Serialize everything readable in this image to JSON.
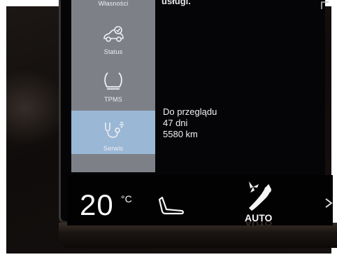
{
  "sidebar": {
    "top_label": "Własności",
    "items": [
      {
        "label": "Status",
        "icon": "car-check-icon"
      },
      {
        "label": "TPMS",
        "icon": "tire-pressure-icon"
      },
      {
        "label": "Serwis",
        "icon": "stethoscope-car-icon",
        "active": true
      }
    ]
  },
  "main": {
    "top_text": "usługi.",
    "service": {
      "title": "Do przeglądu",
      "days": "47 dni",
      "distance": "5580 km"
    }
  },
  "climate": {
    "temperature": "20",
    "unit": "°C",
    "mode": "AUTO"
  },
  "colors": {
    "sidebar_bg": "#7d8187",
    "active_item_bg": "#9bb7d6",
    "screen_bg": "#050507"
  }
}
